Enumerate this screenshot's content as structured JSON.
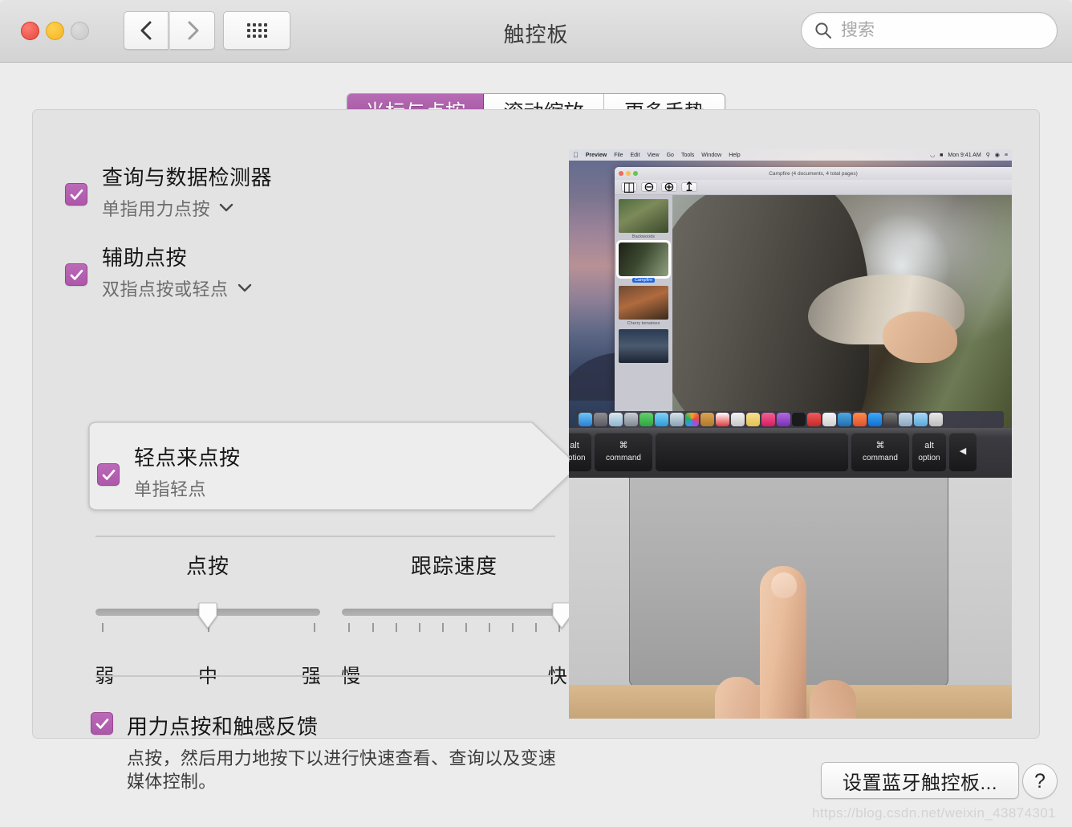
{
  "window": {
    "title": "触控板",
    "traffic_lights": [
      "close",
      "minimize",
      "zoom"
    ]
  },
  "toolbar": {
    "back_icon": "chevron-left-icon",
    "forward_icon": "chevron-right-icon",
    "grid_icon": "grid-view-icon",
    "search": {
      "placeholder": "搜索",
      "value": "",
      "icon": "search-icon"
    }
  },
  "tabs": [
    {
      "label": "光标与点按",
      "active": true
    },
    {
      "label": "滚动缩放",
      "active": false
    },
    {
      "label": "更多手势",
      "active": false
    }
  ],
  "options": [
    {
      "title": "查询与数据检测器",
      "sub": "单指用力点按",
      "checked": true,
      "has_dropdown": true,
      "highlighted": false
    },
    {
      "title": "辅助点按",
      "sub": "双指点按或轻点",
      "checked": true,
      "has_dropdown": true,
      "highlighted": false
    },
    {
      "title": "轻点来点按",
      "sub": "单指轻点",
      "checked": true,
      "has_dropdown": false,
      "highlighted": true
    }
  ],
  "sliders": [
    {
      "name": "click-pressure",
      "title": "点按",
      "labels": [
        "弱",
        "中",
        "强"
      ],
      "ticks": 3,
      "value_percent": 50
    },
    {
      "name": "tracking-speed",
      "title": "跟踪速度",
      "labels": [
        "慢",
        "快"
      ],
      "ticks": 10,
      "value_percent": 100
    }
  ],
  "force_click": {
    "title": "用力点按和触感反馈",
    "description": "点按，然后用力地按下以进行快速查看、查询以及变速媒体控制。",
    "checked": true
  },
  "demo": {
    "menubar": {
      "apple": "",
      "items": [
        "Preview",
        "File",
        "Edit",
        "View",
        "Go",
        "Tools",
        "Window",
        "Help"
      ],
      "clock": "Mon 9:41 AM"
    },
    "preview_window": {
      "title": "Campfire (4 documents, 4 total pages)",
      "thumbnails": [
        {
          "label": "Backwoods",
          "selected": false
        },
        {
          "label": "Campfire",
          "selected": true
        },
        {
          "label": "Cherry tomatoes",
          "selected": false
        },
        {
          "label": "",
          "selected": false
        }
      ]
    },
    "keyboard_keys": [
      {
        "sym": "alt",
        "label": "option"
      },
      {
        "sym": "⌘",
        "label": "command"
      },
      {
        "sym": "",
        "label": ""
      },
      {
        "sym": "⌘",
        "label": "command"
      },
      {
        "sym": "alt",
        "label": "option"
      },
      {
        "sym": "◀",
        "label": ""
      }
    ]
  },
  "footer": {
    "bluetooth_button": "设置蓝牙触控板...",
    "help_button": "?",
    "watermark": "https://blog.csdn.net/weixin_43874301"
  },
  "colors": {
    "accent_purple": "#a95aa7",
    "checkbox_purple": "#ad57ab",
    "window_bg": "#ececec",
    "panel_bg": "#e3e3e3"
  }
}
